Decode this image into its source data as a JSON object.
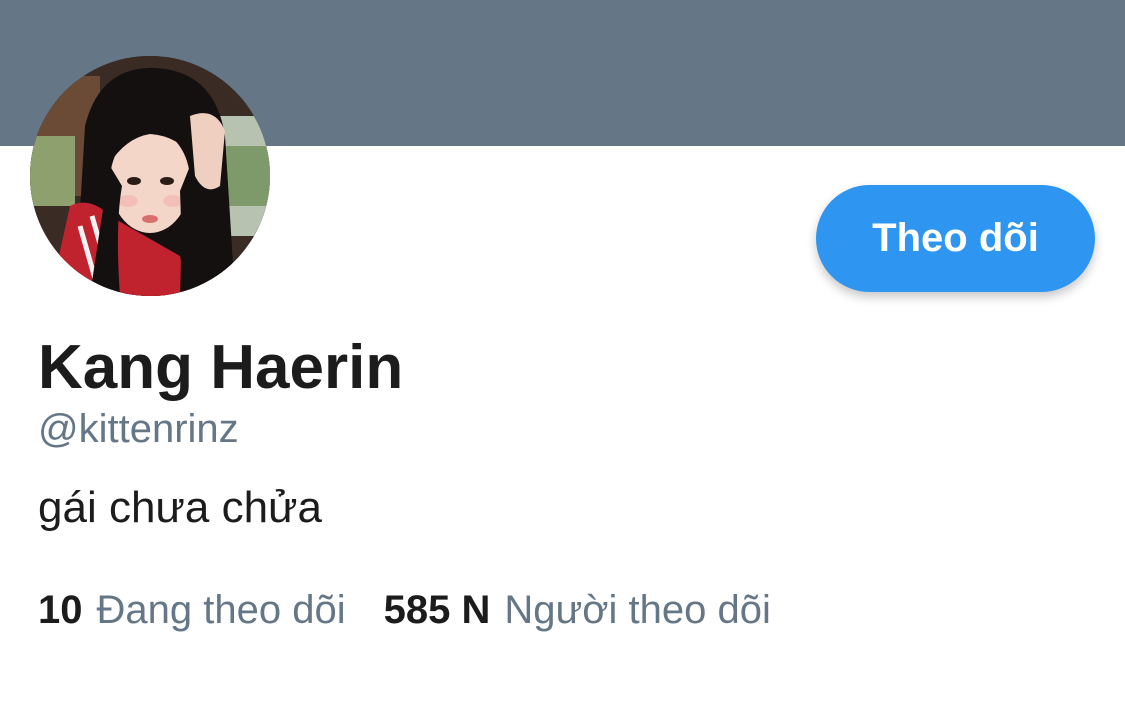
{
  "profile": {
    "display_name": "Kang Haerin",
    "handle": "@kittenrinz",
    "bio": "gái chưa chửa",
    "follow_button_label": "Theo dõi"
  },
  "stats": {
    "following_count": "10",
    "following_label": "Đang theo dõi",
    "followers_count": "585 N",
    "followers_label": "Người theo dõi"
  },
  "colors": {
    "banner": "#657786",
    "accent": "#2e96f0",
    "secondary_text": "#657786",
    "primary_text": "#1c1c1c"
  }
}
